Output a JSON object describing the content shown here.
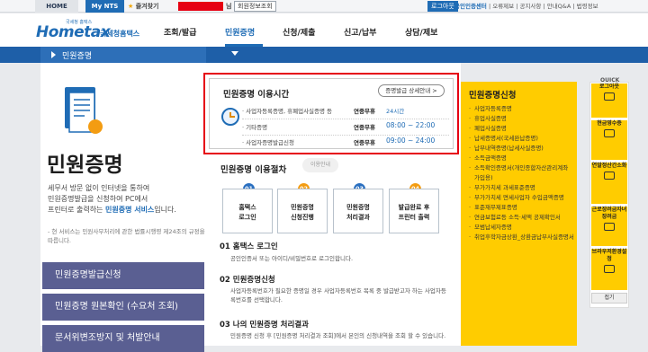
{
  "topbar": {
    "home": "HOME",
    "my_nts": "My NTS",
    "favorites": "즐겨찾기",
    "name_suffix": "님",
    "member_info_button": "회원정보조회",
    "logout_button": "로그아웃",
    "links": [
      "공인인증센터",
      "오류제보",
      "공지사항",
      "안내Q&A",
      "법령정보"
    ]
  },
  "header": {
    "logo_small": "국세청 홈택스",
    "logo_main": "Hometax",
    "logo_sub": "국세청홈택스",
    "gnb": [
      "조회/발급",
      "민원증명",
      "신청/제출",
      "신고/납부",
      "상담/제보"
    ]
  },
  "navbar": {
    "title": "민원증명"
  },
  "left": {
    "title": "민원증명",
    "desc_1": "세무서 방문 없이 인터넷을 통하여",
    "desc_2": "민원증명발급을 신청하여 PC에서",
    "desc_3": "프린터로 출력하는",
    "desc_hl": "민원증명 서비스",
    "desc_4": "입니다.",
    "note": "- 현 서비스는 민원사무처리에 관한 법률시행령 제24조의 규정을 따릅니다.",
    "menu": [
      "민원증명발급신청",
      "민원증명 원본확인 (수요처 조회)",
      "문서위변조방지 및 처발안내"
    ]
  },
  "hours": {
    "title": "민원증명 이용시간",
    "detail_button": "증명발급 상세안내 >",
    "rows": [
      {
        "label": "사업자등록증명, 휴폐업사실증명 등",
        "type": "연중무휴",
        "time": "24시간"
      },
      {
        "label": "기타증명",
        "type": "연중무휴",
        "time": "08:00 ~ 22:00"
      },
      {
        "label": "사업자증명발급신청",
        "type": "연중무휴",
        "time": "09:00 ~ 24:00"
      }
    ]
  },
  "procedure": {
    "title": "민원증명 이용절차",
    "stamp": "이용안내",
    "steps": [
      {
        "num": "01",
        "line1": "홈택스",
        "line2": "로그인",
        "color": "#2a6fc0"
      },
      {
        "num": "02",
        "line1": "민원증명",
        "line2": "신청진행",
        "color": "#f39c12"
      },
      {
        "num": "03",
        "line1": "민원증명",
        "line2": "처리결과",
        "color": "#2a6fc0"
      },
      {
        "num": "04",
        "line1": "발급완료 후",
        "line2": "프린터 출력",
        "color": "#f39c12"
      }
    ],
    "details": [
      {
        "heading": "01 홈택스 로그인",
        "text": "공인인증서 또는 아이디/비밀번호로 로그인합니다."
      },
      {
        "heading": "02 민원증명신청",
        "text": "사업자등록번호가 필요한 증명일 경우 사업자등록번호 목록 중 발급받고자 하는 사업자등록번호를 선택합니다."
      },
      {
        "heading": "03 나의 민원증명 처리결과",
        "text": "민원증명 신청 후 [민원증명 처리결과 조회]에서 본인의 신청내역을 조회 할 수 있습니다."
      }
    ]
  },
  "right": {
    "title": "민원증명신청",
    "items": [
      "사업자등록증명",
      "휴업사실증명",
      "폐업사실증명",
      "납세증명서(국세완납증명)",
      "납부내역증명(납세사실증명)",
      "소득금액증명",
      "소득확인증명서(개인종합자산관리계좌 가입용)",
      "부가가치세 과세표준증명",
      "부가가치세 면세사업자 수입금액증명",
      "표준재무제표증명",
      "연금보험료등 소득·세액 공제확인서",
      "모범납세자증명",
      "취업후학자금상환_상환금납부사실증명서"
    ]
  },
  "quick": {
    "label": "QUICK",
    "items": [
      "로그아웃",
      "현금영수증",
      "연말정산간소화",
      "근로장려금자녀장려금",
      "브라우저환경설정"
    ],
    "close": "접기"
  }
}
